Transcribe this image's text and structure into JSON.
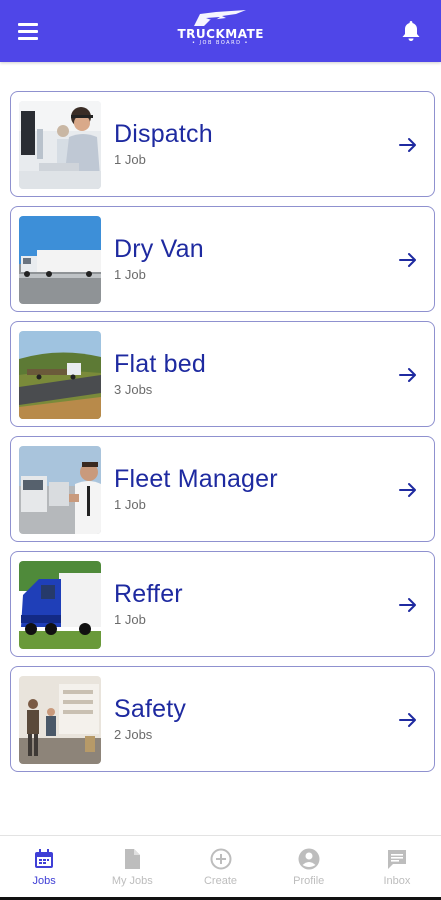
{
  "header": {
    "logo_title": "TRUCKMATE",
    "logo_subtitle": "• JOB BOARD •"
  },
  "jobs": [
    {
      "title": "Dispatch",
      "count": "1 Job"
    },
    {
      "title": "Dry Van",
      "count": "1 Job"
    },
    {
      "title": "Flat bed",
      "count": "3 Jobs"
    },
    {
      "title": "Fleet Manager",
      "count": "1 Job"
    },
    {
      "title": "Reffer",
      "count": "1 Job"
    },
    {
      "title": "Safety",
      "count": "2 Jobs"
    }
  ],
  "tabs": [
    {
      "label": "Jobs",
      "icon": "calendar-icon",
      "active": true
    },
    {
      "label": "My  Jobs",
      "icon": "document-icon",
      "active": false
    },
    {
      "label": "Create",
      "icon": "plus-circle-icon",
      "active": false
    },
    {
      "label": "Profile",
      "icon": "person-icon",
      "active": false
    },
    {
      "label": "Inbox",
      "icon": "message-icon",
      "active": false
    }
  ],
  "colors": {
    "header_bg": "#4f46e8",
    "title_text": "#1e2aa0",
    "card_border": "#8f91cf",
    "tab_active": "#3f3fd6",
    "tab_inactive": "#bdbdbd"
  }
}
